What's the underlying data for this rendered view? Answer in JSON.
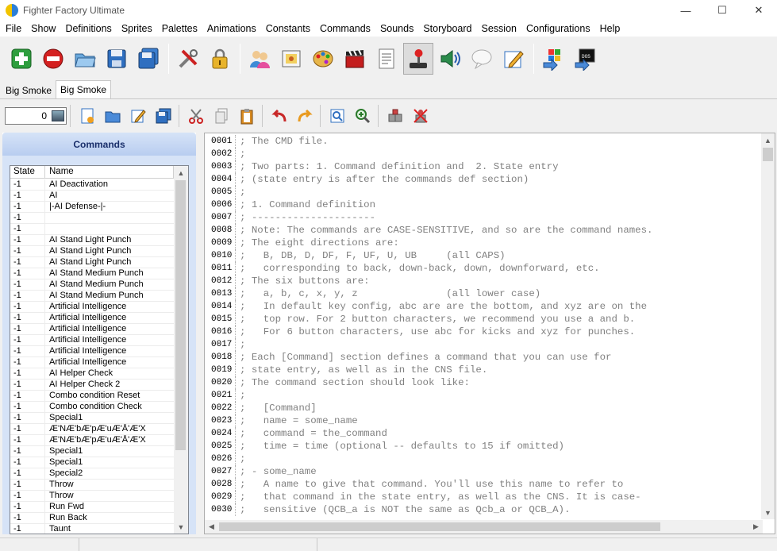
{
  "window": {
    "title": "Fighter Factory Ultimate",
    "minimize": "—",
    "maximize": "☐",
    "close": "✕"
  },
  "menu": [
    "File",
    "Show",
    "Definitions",
    "Sprites",
    "Palettes",
    "Animations",
    "Constants",
    "Commands",
    "Sounds",
    "Storyboard",
    "Session",
    "Configurations",
    "Help"
  ],
  "tabs": [
    {
      "label": "Big Smoke",
      "active": false
    },
    {
      "label": "Big Smoke",
      "active": true
    }
  ],
  "toolbar2": {
    "number_value": "0"
  },
  "commands_panel": {
    "title": "Commands",
    "columns": {
      "state": "State",
      "name": "Name"
    },
    "rows": [
      {
        "state": "-1",
        "name": "AI Deactivation"
      },
      {
        "state": "-1",
        "name": "AI"
      },
      {
        "state": "-1",
        "name": "|-AI Defense-|-"
      },
      {
        "state": "-1",
        "name": ""
      },
      {
        "state": "-1",
        "name": ""
      },
      {
        "state": "-1",
        "name": "AI Stand Light Punch"
      },
      {
        "state": "-1",
        "name": "AI Stand Light Punch"
      },
      {
        "state": "-1",
        "name": "AI Stand Light Punch"
      },
      {
        "state": "-1",
        "name": "AI Stand Medium Punch"
      },
      {
        "state": "-1",
        "name": "AI Stand Medium Punch"
      },
      {
        "state": "-1",
        "name": "AI Stand Medium Punch"
      },
      {
        "state": "-1",
        "name": "Artificial Intelligence"
      },
      {
        "state": "-1",
        "name": "Artificial Intelligence"
      },
      {
        "state": "-1",
        "name": "Artificial Intelligence"
      },
      {
        "state": "-1",
        "name": "Artificial Intelligence"
      },
      {
        "state": "-1",
        "name": "Artificial Intelligence"
      },
      {
        "state": "-1",
        "name": "Artificial Intelligence"
      },
      {
        "state": "-1",
        "name": "AI Helper Check"
      },
      {
        "state": "-1",
        "name": "AI Helper Check 2"
      },
      {
        "state": "-1",
        "name": "Combo condition Reset"
      },
      {
        "state": "-1",
        "name": "Combo condition Check"
      },
      {
        "state": "-1",
        "name": "Special1"
      },
      {
        "state": "-1",
        "name": "Æ'NÆ'bÆ'pÆ'uÆ'Å'Æ'X"
      },
      {
        "state": "-1",
        "name": "Æ'NÆ'bÆ'pÆ'uÆ'Å'Æ'X"
      },
      {
        "state": "-1",
        "name": "Special1"
      },
      {
        "state": "-1",
        "name": "Special1"
      },
      {
        "state": "-1",
        "name": "Special2"
      },
      {
        "state": "-1",
        "name": "Throw"
      },
      {
        "state": "-1",
        "name": "Throw"
      },
      {
        "state": "-1",
        "name": "Run Fwd"
      },
      {
        "state": "-1",
        "name": "Run Back"
      },
      {
        "state": "-1",
        "name": "Taunt"
      }
    ]
  },
  "editor": {
    "lines": [
      {
        "n": "0001",
        "t": "; The CMD file."
      },
      {
        "n": "0002",
        "t": ";"
      },
      {
        "n": "0003",
        "t": "; Two parts: 1. Command definition and  2. State entry"
      },
      {
        "n": "0004",
        "t": "; (state entry is after the commands def section)"
      },
      {
        "n": "0005",
        "t": ";"
      },
      {
        "n": "0006",
        "t": "; 1. Command definition"
      },
      {
        "n": "0007",
        "t": "; ---------------------"
      },
      {
        "n": "0008",
        "t": "; Note: The commands are CASE-SENSITIVE, and so are the command names."
      },
      {
        "n": "0009",
        "t": "; The eight directions are:"
      },
      {
        "n": "0010",
        "t": ";   B, DB, D, DF, F, UF, U, UB     (all CAPS)"
      },
      {
        "n": "0011",
        "t": ";   corresponding to back, down-back, down, downforward, etc."
      },
      {
        "n": "0012",
        "t": "; The six buttons are:"
      },
      {
        "n": "0013",
        "t": ";   a, b, c, x, y, z               (all lower case)"
      },
      {
        "n": "0014",
        "t": ";   In default key config, abc are are the bottom, and xyz are on the"
      },
      {
        "n": "0015",
        "t": ";   top row. For 2 button characters, we recommend you use a and b."
      },
      {
        "n": "0016",
        "t": ";   For 6 button characters, use abc for kicks and xyz for punches."
      },
      {
        "n": "0017",
        "t": ";"
      },
      {
        "n": "0018",
        "t": "; Each [Command] section defines a command that you can use for"
      },
      {
        "n": "0019",
        "t": "; state entry, as well as in the CNS file."
      },
      {
        "n": "0020",
        "t": "; The command section should look like:"
      },
      {
        "n": "0021",
        "t": ";"
      },
      {
        "n": "0022",
        "t": ";   [Command]"
      },
      {
        "n": "0023",
        "t": ";   name = some_name"
      },
      {
        "n": "0024",
        "t": ";   command = the_command"
      },
      {
        "n": "0025",
        "t": ";   time = time (optional -- defaults to 15 if omitted)"
      },
      {
        "n": "0026",
        "t": ";"
      },
      {
        "n": "0027",
        "t": "; - some_name"
      },
      {
        "n": "0028",
        "t": ";   A name to give that command. You'll use this name to refer to"
      },
      {
        "n": "0029",
        "t": ";   that command in the state entry, as well as the CNS. It is case-"
      },
      {
        "n": "0030",
        "t": ";   sensitive (QCB_a is NOT the same as Qcb_a or QCB_A)."
      }
    ]
  },
  "scroll": {
    "left_up": "▲",
    "left_down": "▼",
    "right_up": "▲",
    "right_down": "▼",
    "h_left": "◀",
    "h_right": "▶"
  }
}
